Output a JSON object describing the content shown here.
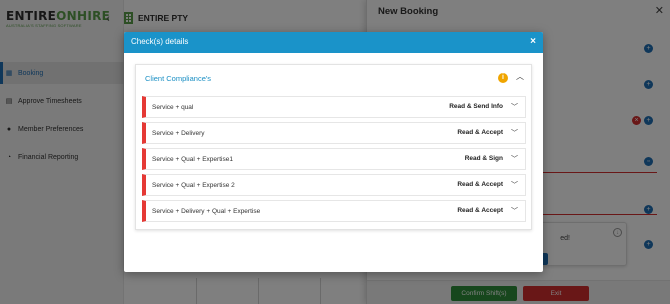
{
  "app": {
    "logo_main": "ENTIRE",
    "logo_accent": "ONHIRE",
    "logo_tagline": "AUSTRALIA'S STAFFING SOFTWARE",
    "client_name": "ENTIRE PTY"
  },
  "sidebar": {
    "items": [
      {
        "label": "Booking",
        "icon": "calendar-icon"
      },
      {
        "label": "Approve Timesheets",
        "icon": "document-icon"
      },
      {
        "label": "Member Preferences",
        "icon": "person-icon"
      },
      {
        "label": "Financial Reporting",
        "icon": "chart-icon"
      }
    ]
  },
  "drawer": {
    "title": "New Booking",
    "notice_text": "ed!",
    "confirm_label": "Confirm Shift(s)",
    "exit_label": "Exit"
  },
  "modal": {
    "title": "Check(s) details",
    "close": "×",
    "section_title": "Client Compliance's",
    "rows": [
      {
        "label": "Service + qual",
        "action": "Read & Send Info"
      },
      {
        "label": "Service + Delivery",
        "action": "Read & Accept"
      },
      {
        "label": "Service + Qual + Expertise1",
        "action": "Read & Sign"
      },
      {
        "label": "Service + Qual + Expertise 2",
        "action": "Read & Accept"
      },
      {
        "label": "Service + Delivery + Qual + Expertise",
        "action": "Read & Accept"
      }
    ]
  },
  "colors": {
    "header_blue": "#1a93c9",
    "row_accent_red": "#e53935",
    "info_orange": "#f0a500",
    "confirm_green": "#2f8f3a",
    "exit_red": "#d32f2f",
    "brand_green": "#5a9e4a"
  }
}
